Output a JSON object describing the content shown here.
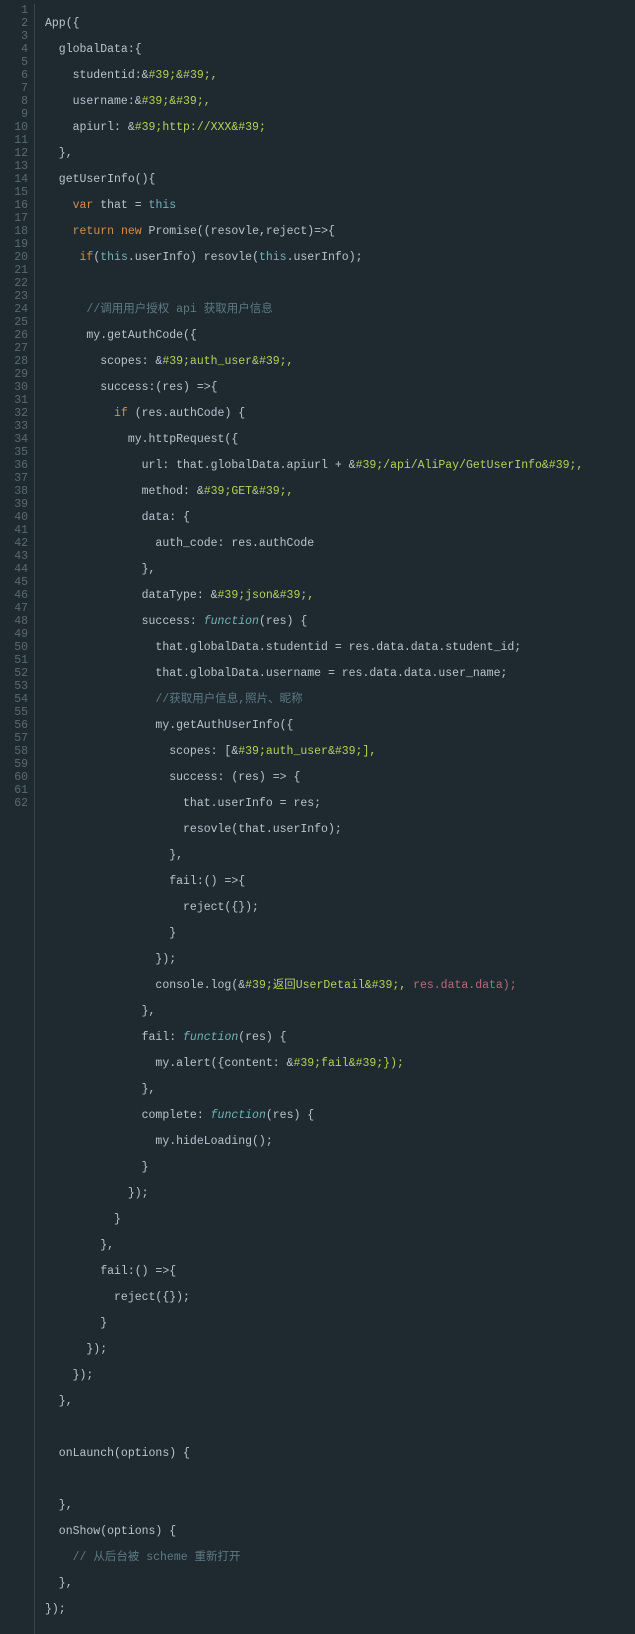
{
  "line_count": 62,
  "code": {
    "l1": "App({",
    "l2": "  globalData:{",
    "l3a": "    studentid:&",
    "l3b": "#39;&#39;,",
    "l4a": "    username:&",
    "l4b": "#39;&#39;,",
    "l5a": "    apiurl: &",
    "l5b": "#39;http://XXX&#39;",
    "l6": "  },",
    "l7": "  getUserInfo(){",
    "l8a": "    ",
    "l8kw": "var",
    "l8b": " that = ",
    "l8this": "this",
    "l9a": "    ",
    "l9kw1": "return",
    "l9sp": " ",
    "l9kw2": "new",
    "l9b": " Promise((resovle,reject)=>{",
    "l10a": "     ",
    "l10kw": "if",
    "l10b": "(",
    "l10this1": "this",
    "l10c": ".userInfo) resovle(",
    "l10this2": "this",
    "l10d": ".userInfo);",
    "l11": "",
    "l12a": "      ",
    "l12cm": "//调用用户授权 api 获取用户信息",
    "l13": "      my.getAuthCode({",
    "l14a": "        scopes: &",
    "l14b": "#39;auth_user&#39;,",
    "l15": "        success:(res) =>{",
    "l16a": "          ",
    "l16kw": "if",
    "l16b": " (res.authCode) {",
    "l17": "            my.httpRequest({",
    "l18a": "              url: that.globalData.apiurl + &",
    "l18b": "#39;/api/AliPay/GetUserInfo&#39;,",
    "l19a": "              method: &",
    "l19b": "#39;GET&#39;,",
    "l20": "              data: {",
    "l21": "                auth_code: res.authCode",
    "l22": "              },",
    "l23a": "              dataType: &",
    "l23b": "#39;json&#39;,",
    "l24a": "              success: ",
    "l24fn": "function",
    "l24b": "(res) {",
    "l25": "                that.globalData.studentid = res.data.data.student_id;",
    "l26": "                that.globalData.username = res.data.data.user_name;",
    "l27a": "                ",
    "l27cm": "//获取用户信息,照片、昵称",
    "l28": "                my.getAuthUserInfo({",
    "l29a": "                  scopes: [&",
    "l29b": "#39;auth_user&#39;],",
    "l30": "                  success: (res) => {",
    "l31": "                    that.userInfo = res;",
    "l32": "                    resovle(that.userInfo);",
    "l33": "                  },",
    "l34": "                  fail:() =>{",
    "l35": "                    reject({});",
    "l36": "                  }",
    "l37": "                });",
    "l38a": "                console.log(&",
    "l38b": "#39;返回UserDetail&#39;,",
    "l38sp": " ",
    "l38c": "res.data.data);",
    "l39": "              },",
    "l40a": "              fail: ",
    "l40fn": "function",
    "l40b": "(res) {",
    "l41a": "                my.alert({content: &",
    "l41b": "#39;fail&#39;});",
    "l42": "              },",
    "l43a": "              complete: ",
    "l43fn": "function",
    "l43b": "(res) {",
    "l44": "                my.hideLoading();",
    "l45": "              }",
    "l46": "            });",
    "l47": "          }",
    "l48": "        },",
    "l49": "        fail:() =>{",
    "l50": "          reject({});",
    "l51": "        }",
    "l52": "      });",
    "l53": "    });",
    "l54": "  },",
    "l55": "",
    "l56": "  onLaunch(options) {",
    "l57": "",
    "l58": "  },",
    "l59": "  onShow(options) {",
    "l60a": "    ",
    "l60cm": "// 从后台被 scheme 重新打开",
    "l61": "  },",
    "l62": "});"
  }
}
